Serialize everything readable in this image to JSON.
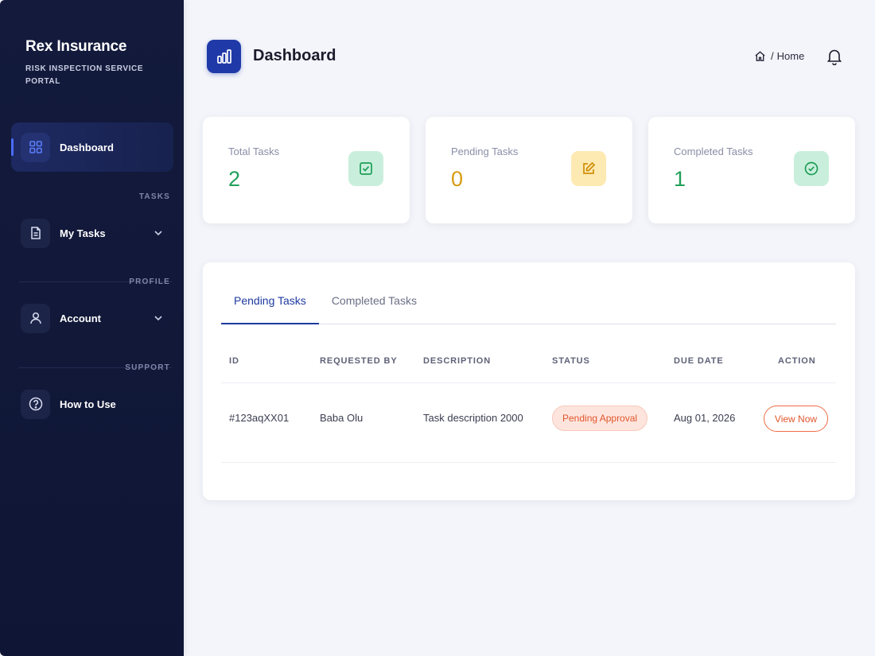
{
  "brand": {
    "name": "Rex Insurance",
    "subtitle": "RISK INSPECTION SERVICE PORTAL"
  },
  "sidebar": {
    "items": [
      {
        "label": "Dashboard",
        "icon": "grid-icon",
        "active": true
      },
      {
        "section": "TASKS",
        "label": "My Tasks",
        "icon": "document-icon",
        "expandable": true
      },
      {
        "section": "PROFILE",
        "label": "Account",
        "icon": "user-icon",
        "expandable": true
      },
      {
        "section": "SUPPORT",
        "label": "How to Use",
        "icon": "help-circle-icon",
        "expandable": false
      }
    ]
  },
  "header": {
    "title": "Dashboard",
    "breadcrumb_sep": "/",
    "breadcrumb": "Home"
  },
  "stats": [
    {
      "label": "Total Tasks",
      "value": "2",
      "color": "#22a05b",
      "icon": "check-square-icon",
      "icon_bg": "#c9efdc"
    },
    {
      "label": "Pending Tasks",
      "value": "0",
      "color": "#d79c12",
      "icon": "edit-icon",
      "icon_bg": "#fde9b2"
    },
    {
      "label": "Completed Tasks",
      "value": "1",
      "color": "#22a05b",
      "icon": "check-circle-icon",
      "icon_bg": "#c9efdc"
    }
  ],
  "tabs": [
    {
      "label": "Pending Tasks",
      "active": true
    },
    {
      "label": "Completed Tasks",
      "active": false
    }
  ],
  "table": {
    "columns": [
      "ID",
      "REQUESTED BY",
      "DESCRIPTION",
      "STATUS",
      "DUE DATE",
      "ACTION"
    ],
    "rows": [
      {
        "id": "#123aqXX01",
        "requested_by": "Baba Olu",
        "description": "Task description 2000",
        "status": "Pending Approval",
        "due_date": "Aug 01, 2026",
        "action": "View Now"
      }
    ]
  },
  "colors": {
    "sidebar_bg": "#131a3c",
    "accent": "#1f3aa8",
    "badge_text": "#e0562c"
  }
}
